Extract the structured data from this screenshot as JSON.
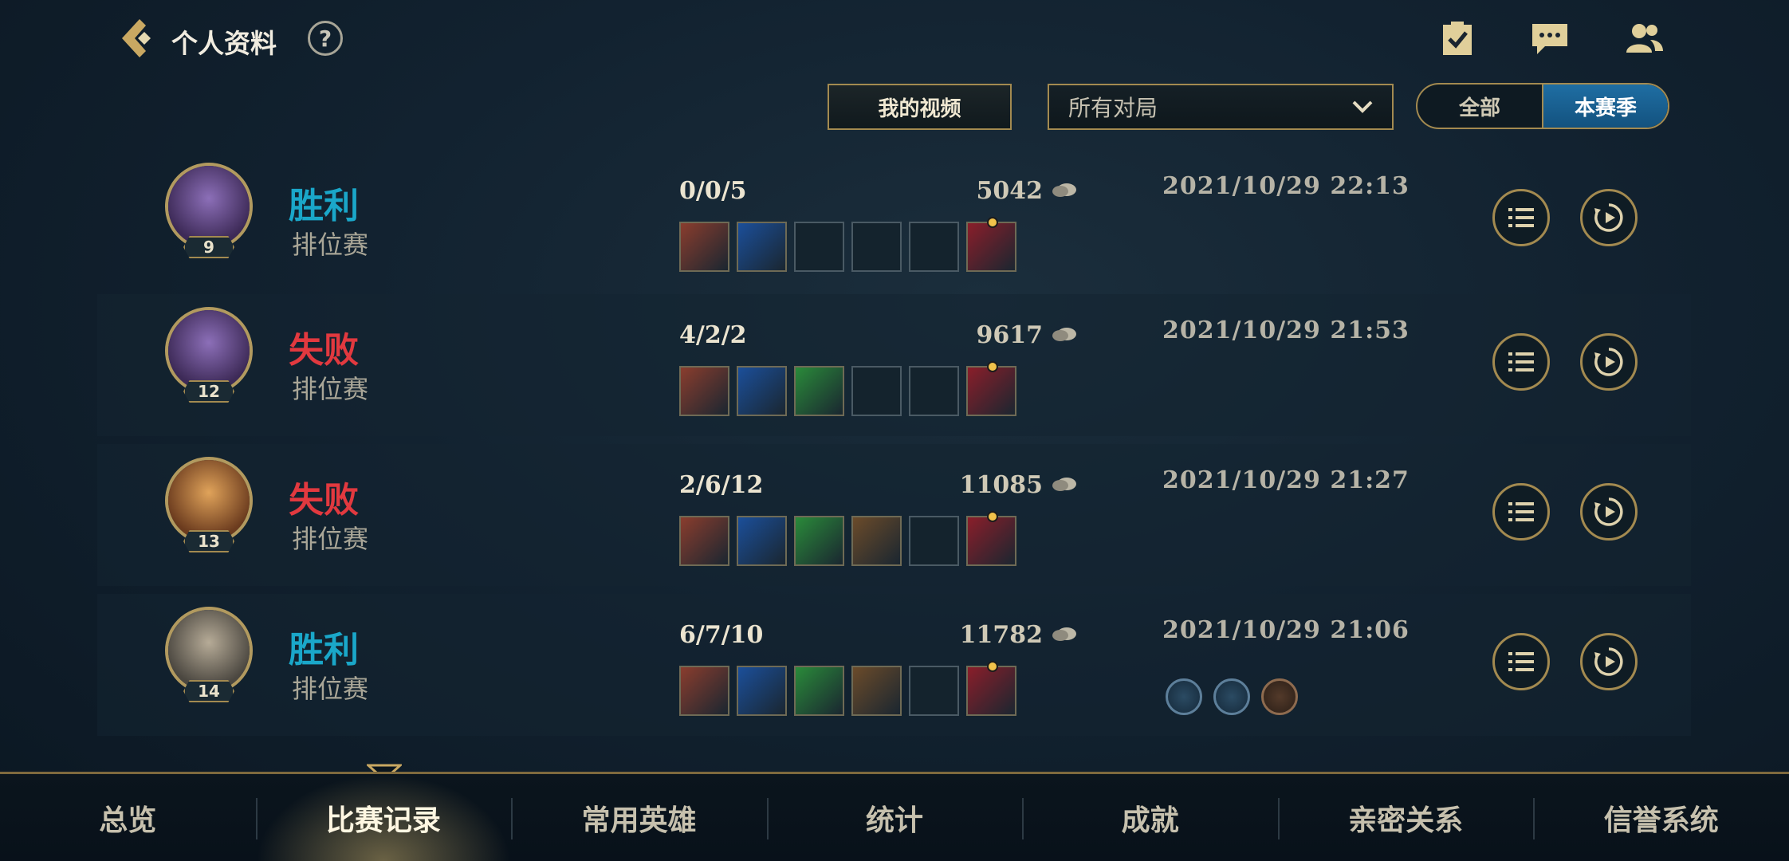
{
  "header": {
    "title": "个人资料",
    "help_label": "?"
  },
  "filters": {
    "video_button": "我的视频",
    "match_type_selected": "所有对局",
    "season_toggle": [
      "全部",
      "本赛季"
    ],
    "season_toggle_active": "本赛季"
  },
  "matches": [
    {
      "level": "9",
      "result": "胜利",
      "result_type": "win",
      "mode": "排位赛",
      "kda": "0/0/5",
      "gold": "5042",
      "datetime": "2021/10/29 22:13",
      "items": [
        "item-1",
        "item-2",
        "",
        "",
        "",
        "boots"
      ]
    },
    {
      "level": "12",
      "result": "失败",
      "result_type": "loss",
      "mode": "排位赛",
      "kda": "4/2/2",
      "gold": "9617",
      "datetime": "2021/10/29 21:53",
      "items": [
        "item-1",
        "item-2",
        "item-3",
        "",
        "",
        "boots"
      ]
    },
    {
      "level": "13",
      "result": "失败",
      "result_type": "loss",
      "mode": "排位赛",
      "kda": "2/6/12",
      "gold": "11085",
      "datetime": "2021/10/29 21:27",
      "items": [
        "item-1",
        "item-2",
        "item-3",
        "item-4",
        "",
        "trinket"
      ]
    },
    {
      "level": "14",
      "result": "胜利",
      "result_type": "win",
      "mode": "排位赛",
      "kda": "6/7/10",
      "gold": "11782",
      "datetime": "2021/10/29 21:06",
      "items": [
        "item-1",
        "item-2",
        "item-3",
        "item-4",
        "",
        "trinket"
      ],
      "medals": [
        "silver-medal",
        "silver-medal",
        "bronze-medal"
      ]
    }
  ],
  "bottom_nav": {
    "tabs": [
      "总览",
      "比赛记录",
      "常用英雄",
      "统计",
      "成就",
      "亲密关系",
      "信誉系统"
    ],
    "active": "比赛记录"
  },
  "colors": {
    "win": "#1aa7c9",
    "loss": "#e2393f",
    "gold_border": "#a38a50"
  }
}
